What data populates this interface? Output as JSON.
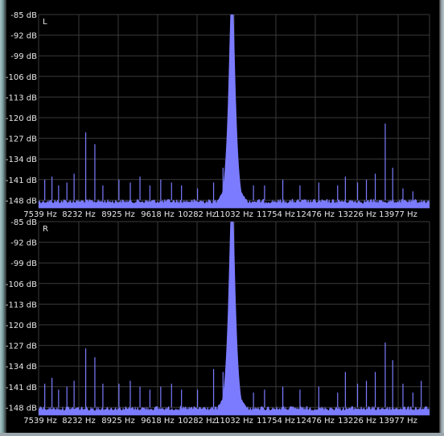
{
  "colors": {
    "background": "#000000",
    "grid": "#3a3a3a",
    "spectrum": "#7b7bff",
    "text": "#e8e8e8"
  },
  "chart_data": [
    {
      "type": "area",
      "channel_label": "L",
      "y_tick_labels": [
        "-85 dB",
        "-92 dB",
        "-99 dB",
        "-106 dB",
        "-113 dB",
        "-120 dB",
        "-127 dB",
        "-134 dB",
        "-141 dB",
        "-148 dB"
      ],
      "x_tick_labels": [
        "7539 Hz",
        "8232 Hz",
        "8925 Hz",
        "9618 Hz",
        "10282 Hz",
        "11032 Hz",
        "11754 Hz",
        "12476 Hz",
        "13226 Hz",
        "13977 Hz"
      ],
      "xlim": [
        7539,
        14600
      ],
      "ylim": [
        -150,
        -85
      ],
      "unit_x": "Hz",
      "unit_y": "dB",
      "noise_floor_db": -148,
      "peak": {
        "x": 11032,
        "y": -85
      },
      "spurs": [
        {
          "x": 7650,
          "y": -141
        },
        {
          "x": 7780,
          "y": -140
        },
        {
          "x": 7900,
          "y": -143
        },
        {
          "x": 8050,
          "y": -142
        },
        {
          "x": 8180,
          "y": -139
        },
        {
          "x": 8390,
          "y": -125
        },
        {
          "x": 8555,
          "y": -129
        },
        {
          "x": 8700,
          "y": -143
        },
        {
          "x": 8990,
          "y": -141
        },
        {
          "x": 9195,
          "y": -142
        },
        {
          "x": 9370,
          "y": -140
        },
        {
          "x": 9550,
          "y": -143
        },
        {
          "x": 9745,
          "y": -141
        },
        {
          "x": 9940,
          "y": -142
        },
        {
          "x": 10120,
          "y": -143
        },
        {
          "x": 10410,
          "y": -144
        },
        {
          "x": 10700,
          "y": -142
        },
        {
          "x": 10870,
          "y": -137
        },
        {
          "x": 11420,
          "y": -143
        },
        {
          "x": 11620,
          "y": -143
        },
        {
          "x": 11950,
          "y": -141
        },
        {
          "x": 12260,
          "y": -143
        },
        {
          "x": 12600,
          "y": -142
        },
        {
          "x": 12940,
          "y": -143
        },
        {
          "x": 13080,
          "y": -140
        },
        {
          "x": 13300,
          "y": -142
        },
        {
          "x": 13460,
          "y": -141
        },
        {
          "x": 13620,
          "y": -139
        },
        {
          "x": 13800,
          "y": -122
        },
        {
          "x": 13935,
          "y": -137
        },
        {
          "x": 14120,
          "y": -144
        },
        {
          "x": 14300,
          "y": -145
        }
      ]
    },
    {
      "type": "area",
      "channel_label": "R",
      "y_tick_labels": [
        "-85 dB",
        "-92 dB",
        "-99 dB",
        "-106 dB",
        "-113 dB",
        "-120 dB",
        "-127 dB",
        "-134 dB",
        "-141 dB",
        "-148 dB"
      ],
      "x_tick_labels": [
        "7539 Hz",
        "8232 Hz",
        "8925 Hz",
        "9618 Hz",
        "10282 Hz",
        "11032 Hz",
        "11754 Hz",
        "12476 Hz",
        "13226 Hz",
        "13977 Hz"
      ],
      "xlim": [
        7539,
        14600
      ],
      "ylim": [
        -150,
        -85
      ],
      "unit_x": "Hz",
      "unit_y": "dB",
      "noise_floor_db": -148,
      "peak": {
        "x": 11032,
        "y": -85
      },
      "spurs": [
        {
          "x": 7650,
          "y": -140
        },
        {
          "x": 7780,
          "y": -138
        },
        {
          "x": 7900,
          "y": -142
        },
        {
          "x": 8050,
          "y": -141
        },
        {
          "x": 8180,
          "y": -139
        },
        {
          "x": 8390,
          "y": -128
        },
        {
          "x": 8555,
          "y": -131
        },
        {
          "x": 8700,
          "y": -140
        },
        {
          "x": 8990,
          "y": -140
        },
        {
          "x": 9195,
          "y": -139
        },
        {
          "x": 9370,
          "y": -141
        },
        {
          "x": 9550,
          "y": -142
        },
        {
          "x": 9745,
          "y": -141
        },
        {
          "x": 9940,
          "y": -140
        },
        {
          "x": 10120,
          "y": -142
        },
        {
          "x": 10410,
          "y": -142
        },
        {
          "x": 10700,
          "y": -135
        },
        {
          "x": 10870,
          "y": -136
        },
        {
          "x": 11420,
          "y": -143
        },
        {
          "x": 11620,
          "y": -142
        },
        {
          "x": 11950,
          "y": -141
        },
        {
          "x": 12260,
          "y": -142
        },
        {
          "x": 12600,
          "y": -141
        },
        {
          "x": 12940,
          "y": -143
        },
        {
          "x": 13080,
          "y": -136
        },
        {
          "x": 13300,
          "y": -140
        },
        {
          "x": 13460,
          "y": -139
        },
        {
          "x": 13620,
          "y": -136
        },
        {
          "x": 13800,
          "y": -126
        },
        {
          "x": 13935,
          "y": -132
        },
        {
          "x": 14120,
          "y": -140
        },
        {
          "x": 14300,
          "y": -143
        },
        {
          "x": 14450,
          "y": -139
        }
      ]
    }
  ]
}
